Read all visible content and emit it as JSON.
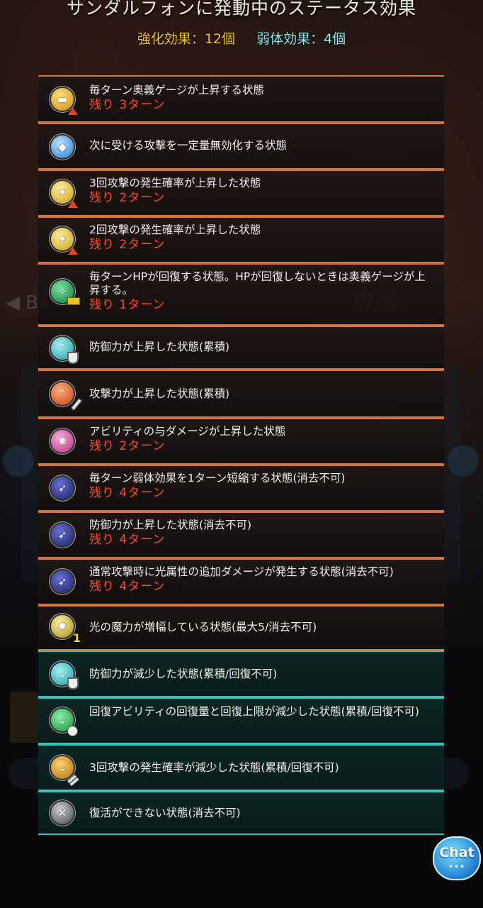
{
  "header": {
    "title": "サンダルフォンに発動中のステータス効果",
    "buff_count": "強化効果：12個",
    "debuff_count": "弱体効果：4個"
  },
  "background": {
    "back_label": "◀ Back",
    "attack_label": "攻撃"
  },
  "effects": [
    {
      "desc": "毎ターン奥義ゲージが上昇する状態",
      "turns": "残り 3ターン",
      "icon": "gauge-up-icon"
    },
    {
      "desc": "次に受ける攻撃を一定量無効化する状態",
      "turns": "",
      "icon": "barrier-crystal-icon"
    },
    {
      "desc": "3回攻撃の発生確率が上昇した状態",
      "turns": "残り 2ターン",
      "icon": "triple-attack-up-icon"
    },
    {
      "desc": "2回攻撃の発生確率が上昇した状態",
      "turns": "残り 2ターン",
      "icon": "double-attack-up-icon"
    },
    {
      "desc": "毎ターンHPが回復する状態。HPが回復しないときは奥義ゲージが上昇する。",
      "turns": "残り 1ターン",
      "icon": "regen-icon"
    },
    {
      "desc": "防御力が上昇した状態(累積)",
      "turns": "",
      "icon": "defense-up-stack-icon"
    },
    {
      "desc": "攻撃力が上昇した状態(累積)",
      "turns": "",
      "icon": "attack-up-stack-icon"
    },
    {
      "desc": "アビリティの与ダメージが上昇した状態",
      "turns": "残り 2ターン",
      "icon": "ability-damage-up-icon"
    },
    {
      "desc": "毎ターン弱体効果を1ターン短縮する状態(消去不可)",
      "turns": "残り 4ターン",
      "icon": "feather-debuff-shorten-icon"
    },
    {
      "desc": "防御力が上昇した状態(消去不可)",
      "turns": "残り 4ターン",
      "icon": "feather-defense-up-icon"
    },
    {
      "desc": "通常攻撃時に光属性の追加ダメージが発生する状態(消去不可)",
      "turns": "残り 4ターン",
      "icon": "feather-light-echo-icon"
    },
    {
      "desc": "光の魔力が増幅している状態(最大5/消去不可)",
      "turns": "",
      "icon": "light-power-stack-icon"
    },
    {
      "desc": "防御力が減少した状態(累積/回復不可)",
      "turns": "",
      "icon": "defense-down-icon"
    },
    {
      "desc": "回復アビリティの回復量と回復上限が減少した状態(累積/回復不可)",
      "turns": "",
      "icon": "heal-down-icon"
    },
    {
      "desc": "3回攻撃の発生確率が減少した状態(累積/回復不可)",
      "turns": "",
      "icon": "triple-attack-down-icon"
    },
    {
      "desc": "復活ができない状態(消去不可)",
      "turns": "",
      "icon": "no-revive-icon"
    }
  ],
  "chat": {
    "label": "Chat",
    "dots": "•••"
  },
  "colors": {
    "buff_border": "#d8743c",
    "debuff_border": "#39c0b8",
    "turns_text": "#ff4b26",
    "buff_count": "#f5c423",
    "debuff_count": "#8fe6f0"
  }
}
